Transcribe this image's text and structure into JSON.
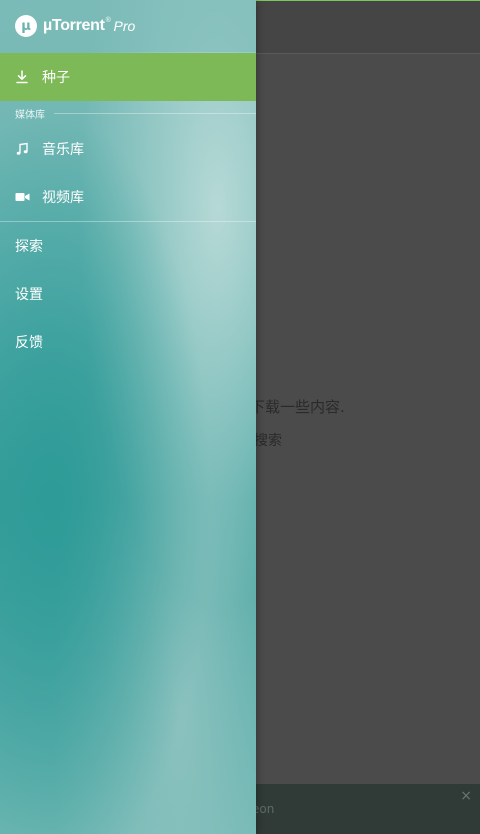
{
  "app": {
    "logo_mark": "μ",
    "brand": "µTorrent",
    "reg_mark": "®",
    "edition": "Pro"
  },
  "drawer": {
    "items": [
      {
        "label": "种子",
        "icon": "download-icon",
        "active": true
      },
      {
        "label": "音乐库",
        "icon": "music-note-icon"
      },
      {
        "label": "视频库",
        "icon": "video-camera-icon"
      },
      {
        "label": "探索"
      },
      {
        "label": "设置"
      },
      {
        "label": "反馈"
      }
    ],
    "section_media": "媒体库"
  },
  "background": {
    "line1": ",",
    "line2": "下载一些内容.",
    "line3": "搜索",
    "banner_text": "eon",
    "banner_close": "×"
  },
  "colors": {
    "active_item": "#7db956",
    "drawer_teal": "#3b9f9b",
    "overlay": "#4b4b4b"
  }
}
